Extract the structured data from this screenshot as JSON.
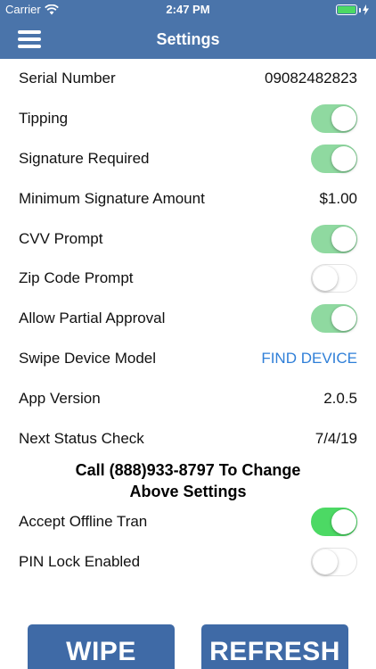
{
  "status_bar": {
    "carrier": "Carrier",
    "time": "2:47 PM"
  },
  "nav": {
    "title": "Settings"
  },
  "settings": {
    "serial_number": {
      "label": "Serial Number",
      "value": "09082482823"
    },
    "tipping": {
      "label": "Tipping",
      "enabled": true
    },
    "signature_required": {
      "label": "Signature Required",
      "enabled": true
    },
    "min_signature_amount": {
      "label": "Minimum Signature Amount",
      "value": "$1.00"
    },
    "cvv_prompt": {
      "label": "CVV Prompt",
      "enabled": true
    },
    "zip_code_prompt": {
      "label": "Zip Code Prompt",
      "enabled": false
    },
    "allow_partial_approval": {
      "label": "Allow Partial Approval",
      "enabled": true
    },
    "swipe_device_model": {
      "label": "Swipe Device Model",
      "action": "FIND DEVICE"
    },
    "app_version": {
      "label": "App Version",
      "value": "2.0.5"
    },
    "next_status_check": {
      "label": "Next Status Check",
      "value": "7/4/19"
    }
  },
  "notice": {
    "line1": "Call (888)933-8797 To Change",
    "line2": "Above Settings"
  },
  "local_settings": {
    "accept_offline_tran": {
      "label": "Accept Offline Tran",
      "enabled": true
    },
    "pin_lock_enabled": {
      "label": "PIN Lock Enabled",
      "enabled": false
    }
  },
  "buttons": {
    "wipe": "WIPE",
    "refresh": "REFRESH"
  },
  "colors": {
    "nav_blue": "#4a74aa",
    "button_blue": "#3f6aa6",
    "switch_on": "#4cd964",
    "link": "#2f7fd8"
  },
  "icons": {
    "wifi": "wifi-icon",
    "battery": "battery-icon",
    "charging": "charging-bolt-icon",
    "menu": "hamburger-menu-icon"
  }
}
